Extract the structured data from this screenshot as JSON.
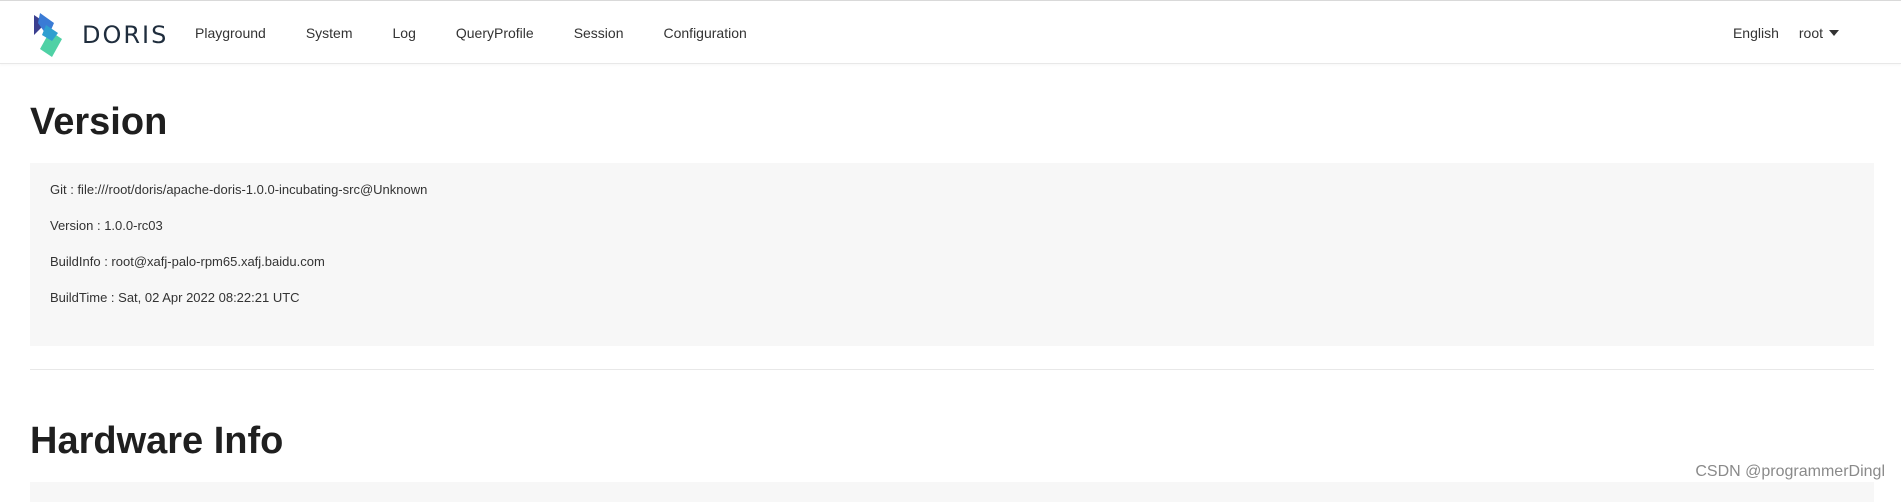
{
  "header": {
    "brand": "DORIS",
    "nav": [
      {
        "label": "Playground"
      },
      {
        "label": "System"
      },
      {
        "label": "Log"
      },
      {
        "label": "QueryProfile"
      },
      {
        "label": "Session"
      },
      {
        "label": "Configuration"
      }
    ],
    "language": "English",
    "user": "root"
  },
  "sections": {
    "version": {
      "title": "Version",
      "lines": [
        "Git : file:///root/doris/apache-doris-1.0.0-incubating-src@Unknown",
        "Version : 1.0.0-rc03",
        "BuildInfo : root@xafj-palo-rpm65.xafj.baidu.com",
        "BuildTime : Sat, 02 Apr 2022 08:22:21 UTC"
      ]
    },
    "hardware": {
      "title": "Hardware Info"
    }
  },
  "watermark": "CSDN @programmerDingl",
  "colors": {
    "logo_dark": "#3b3f8f",
    "logo_blue": "#3a7bd5",
    "logo_green": "#4fd1a5",
    "panel_bg": "#f7f7f7"
  }
}
